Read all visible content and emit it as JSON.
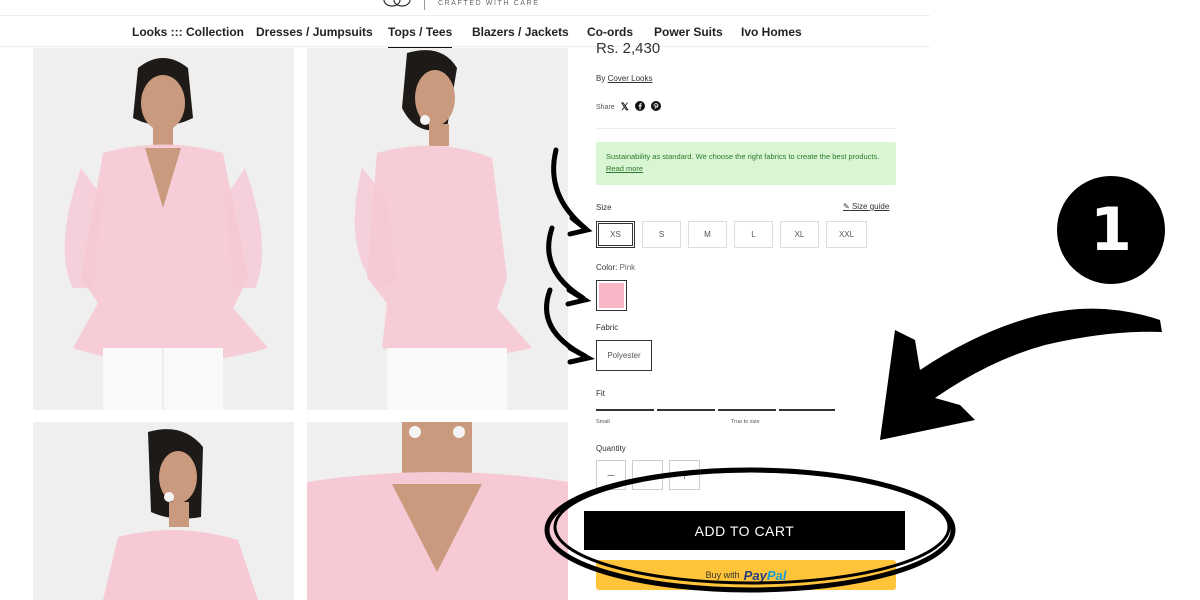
{
  "header": {
    "tagline": "CRAFTED WITH CARE",
    "logo_icon": "brand-logo-icon"
  },
  "nav": {
    "items": [
      {
        "label": "Looks ::: Collection"
      },
      {
        "label": "Dresses / Jumpsuits"
      },
      {
        "label": "Tops / Tees",
        "active": true
      },
      {
        "label": "Blazers / Jackets"
      },
      {
        "label": "Co-ords"
      },
      {
        "label": "Power Suits"
      },
      {
        "label": "Ivo Homes"
      }
    ]
  },
  "product": {
    "price": "Rs. 2,430",
    "by_label": "By",
    "vendor": "Cover Looks",
    "share_label": "Share",
    "share_icons": [
      "x-icon",
      "facebook-icon",
      "pinterest-icon"
    ],
    "notice": {
      "text": "Sustainability as standard. We choose the right fabrics to create the best products.",
      "link": "Read more"
    },
    "size": {
      "label": "Size",
      "guide": "Size guide",
      "options": [
        "XS",
        "S",
        "M",
        "L",
        "XL",
        "XXL"
      ],
      "selected": "XS"
    },
    "color": {
      "label": "Color:",
      "value": "Pink",
      "swatch": "#f9b6c7"
    },
    "fabric": {
      "label": "Fabric",
      "options": [
        "Polyester"
      ]
    },
    "fit": {
      "label": "Fit",
      "low": "Small",
      "mid": "True to size"
    },
    "quantity": {
      "label": "Quantity",
      "minus": "−",
      "value": "",
      "plus": "+"
    },
    "add_to_cart": "ADD TO CART",
    "paypal": {
      "prefix": "Buy with",
      "brand_a": "Pay",
      "brand_b": "Pal"
    }
  },
  "annotation": {
    "step": "1"
  },
  "colors": {
    "accent": "#000000",
    "notice_bg": "#d9f5d3",
    "paypal_bg": "#ffc439"
  }
}
